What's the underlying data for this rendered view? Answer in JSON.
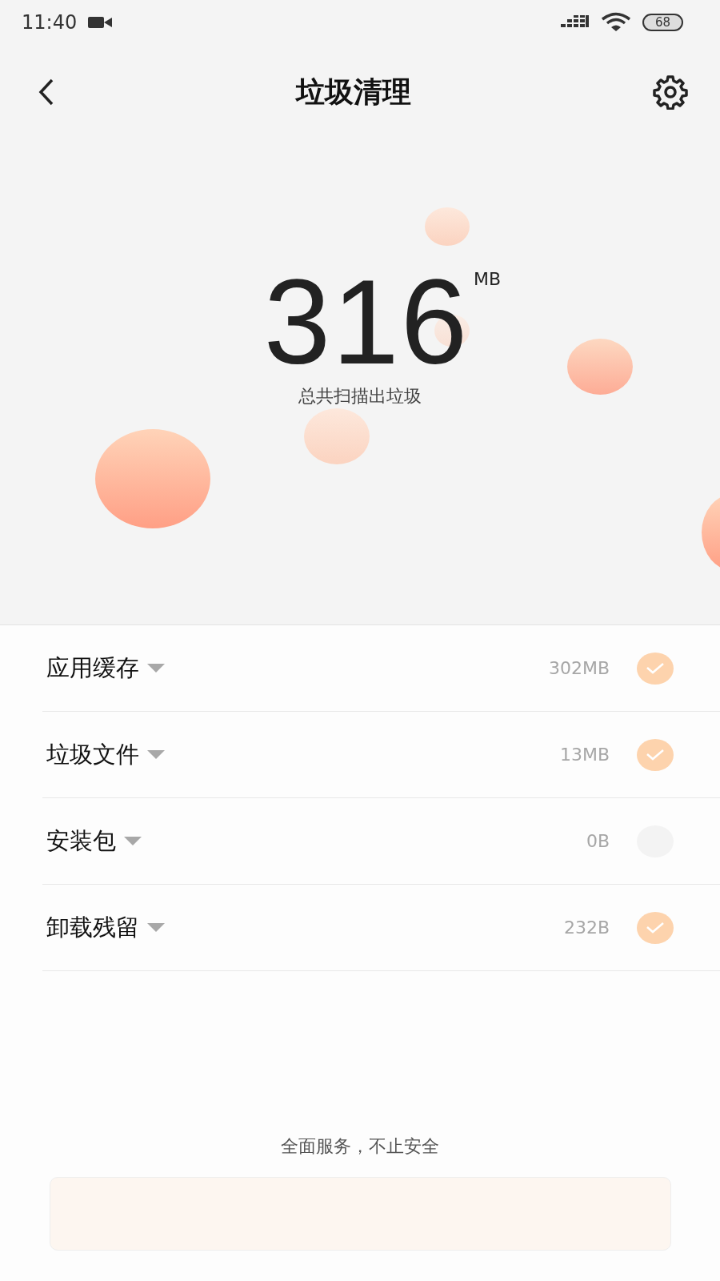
{
  "status_bar": {
    "time": "11:40",
    "battery": "68"
  },
  "header": {
    "title": "垃圾清理"
  },
  "summary": {
    "amount": "316",
    "unit": "MB",
    "caption": "总共扫描出垃圾"
  },
  "items": [
    {
      "label": "应用缓存",
      "size": "302MB",
      "checked": true
    },
    {
      "label": "垃圾文件",
      "size": "13MB",
      "checked": true
    },
    {
      "label": "安装包",
      "size": "0B",
      "checked": false
    },
    {
      "label": "卸载残留",
      "size": "232B",
      "checked": true
    }
  ],
  "footer": {
    "slogan": "全面服务，不止安全"
  }
}
